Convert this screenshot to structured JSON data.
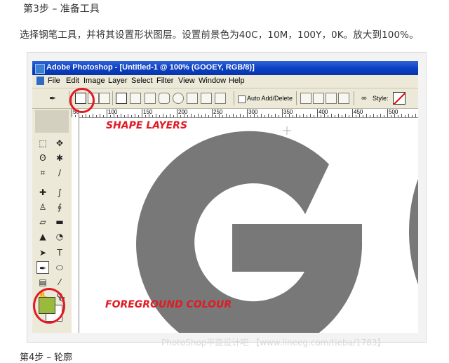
{
  "article": {
    "step_title": "第3步 – 准备工具",
    "instruction": "选择钢笔工具，并将其设置形状图层。设置前景色为40C，10M，100Y，0K。放大到100%。",
    "next_step_partial": "第4步 – 轮廓"
  },
  "window": {
    "title": "Adobe Photoshop - [Untitled-1 @ 100% (GOOEY, RGB/8)]"
  },
  "menu": {
    "items": [
      "File",
      "Edit",
      "Image",
      "Layer",
      "Select",
      "Filter",
      "View",
      "Window",
      "Help"
    ]
  },
  "options_bar": {
    "auto_add_label": "Auto Add/Delete",
    "style_label": "Style:"
  },
  "ruler": {
    "labels": [
      "50",
      "100",
      "150",
      "200",
      "250",
      "300",
      "350",
      "400",
      "450",
      "500",
      "550",
      "600"
    ]
  },
  "canvas": {
    "text": "GO"
  },
  "annotations": {
    "shape_layers": "SHAPE LAYERS",
    "foreground_colour": "FOREGROUND COLOUR"
  },
  "watermark": "PhotoShop平面设计吧 【www.lineeg.com/tieba/1783】",
  "colors": {
    "foreground": "#9aba3c",
    "highlight": "#e01b24",
    "letter_gray": "#787878",
    "titlebar_blue": "#0a3ec2"
  },
  "icons": {
    "pen_tool": "pen-icon",
    "shape_layers_mode": "shape-layers-icon",
    "paths_mode": "paths-icon",
    "fill_pixels_mode": "fill-pixels-icon",
    "rectangle": "rectangle-icon",
    "rounded_rectangle": "rounded-rectangle-icon",
    "ellipse": "ellipse-icon",
    "polygon": "polygon-icon",
    "line": "line-icon",
    "custom_shape": "custom-shape-icon",
    "link": "link-icon"
  }
}
